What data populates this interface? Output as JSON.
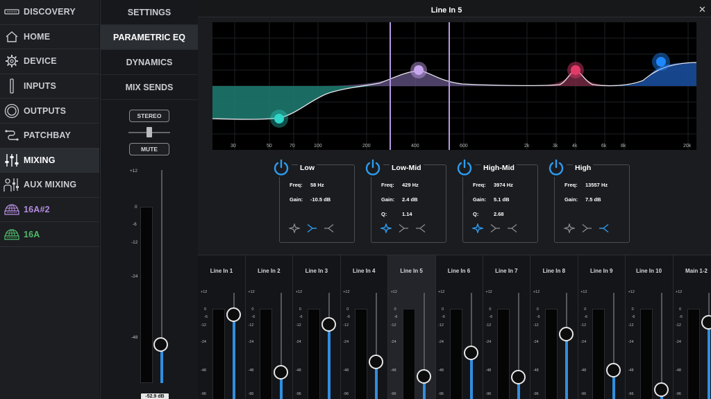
{
  "sidebar": {
    "items": [
      {
        "label": "DISCOVERY",
        "icon": "device-rack-icon"
      },
      {
        "label": "HOME",
        "icon": "home-icon"
      },
      {
        "label": "DEVICE",
        "icon": "gear-icon"
      },
      {
        "label": "INPUTS",
        "icon": "input-bar-icon"
      },
      {
        "label": "OUTPUTS",
        "icon": "speaker-icon"
      },
      {
        "label": "PATCHBAY",
        "icon": "patchbay-icon"
      },
      {
        "label": "MIXING",
        "icon": "sliders-icon",
        "active": true
      },
      {
        "label": "AUX MIXING",
        "icon": "aux-mix-icon"
      },
      {
        "label": "16A#2",
        "icon": "globe-device-icon",
        "color": "#b58be0"
      },
      {
        "label": "16A",
        "icon": "globe-device-icon",
        "color": "#4fb86a"
      }
    ]
  },
  "subnav": {
    "items": [
      {
        "label": "SETTINGS"
      },
      {
        "label": "PARAMETRIC EQ",
        "active": true
      },
      {
        "label": "DYNAMICS"
      },
      {
        "label": "MIX SENDS"
      }
    ],
    "stereo_label": "STEREO",
    "mute_label": "MUTE",
    "scale": [
      "+12",
      "0",
      "-6",
      "-12",
      "-24",
      "-48"
    ],
    "fader_level_db": -52.9,
    "fader_readout": "-52.9 dB"
  },
  "main": {
    "title": "Line In 5",
    "close_glyph": "✕"
  },
  "eq": {
    "freq_ticks": [
      "30",
      "50",
      "70",
      "100",
      "200",
      "400",
      "600",
      "2k",
      "3k",
      "4k",
      "6k",
      "8k",
      "20k"
    ],
    "bands": [
      {
        "name": "Low",
        "freq_label": "Freq:",
        "freq": "58 Hz",
        "gain_label": "Gain:",
        "gain": "-10.5 dB",
        "q_label": "",
        "q": "",
        "color": "#2fd6c9",
        "shape": "low-shelf",
        "powered": true
      },
      {
        "name": "Low-Mid",
        "freq_label": "Freq:",
        "freq": "429 Hz",
        "gain_label": "Gain:",
        "gain": "2.4 dB",
        "q_label": "Q:",
        "q": "1.14",
        "color": "#c8a6f0",
        "shape": "bell",
        "powered": true
      },
      {
        "name": "High-Mid",
        "freq_label": "Freq:",
        "freq": "3974 Hz",
        "gain_label": "Gain:",
        "gain": "5.1 dB",
        "q_label": "Q:",
        "q": "2.68",
        "color": "#e23b6a",
        "shape": "bell",
        "powered": true
      },
      {
        "name": "High",
        "freq_label": "Freq:",
        "freq": "13557 Hz",
        "gain_label": "Gain:",
        "gain": "7.5 dB",
        "q_label": "",
        "q": "",
        "color": "#1f88ff",
        "shape": "high-shelf",
        "powered": true
      }
    ]
  },
  "mixer": {
    "scale": [
      "+12",
      "0",
      "-6",
      "-12",
      "-24",
      "-48",
      "-96"
    ],
    "channels": [
      {
        "name": "Line In 1",
        "level": 0.8
      },
      {
        "name": "Line In 2",
        "level": 0.2
      },
      {
        "name": "Line In 3",
        "level": 0.7
      },
      {
        "name": "Line In 4",
        "level": 0.31
      },
      {
        "name": "Line In 5",
        "level": 0.16,
        "selected": true
      },
      {
        "name": "Line In 6",
        "level": 0.4
      },
      {
        "name": "Line In 7",
        "level": 0.15
      },
      {
        "name": "Line In 8",
        "level": 0.6
      },
      {
        "name": "Line In 9",
        "level": 0.22
      },
      {
        "name": "Line In 10",
        "level": 0.02
      },
      {
        "name": "Main 1-2",
        "level": 0.72
      }
    ]
  }
}
